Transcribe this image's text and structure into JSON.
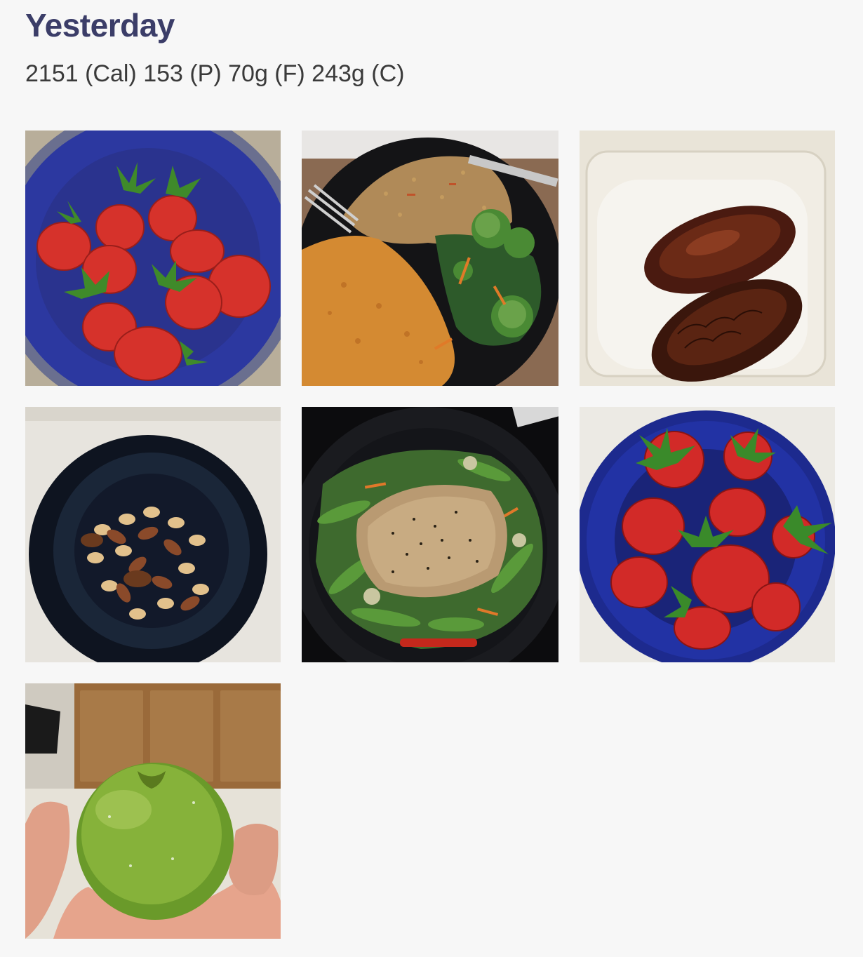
{
  "day": {
    "title": "Yesterday",
    "macros": "2151 (Cal) 153 (P) 70g (F) 243g (C)"
  },
  "photos": [
    {
      "subject": "strawberries-in-blue-bowl"
    },
    {
      "subject": "salmon-rice-vegetables-plate"
    },
    {
      "subject": "dates-in-container"
    },
    {
      "subject": "mixed-nuts-in-black-bowl"
    },
    {
      "subject": "chicken-stir-fry-in-pan"
    },
    {
      "subject": "strawberries-in-blue-bowl"
    },
    {
      "subject": "green-apple-in-hand"
    }
  ],
  "colors": {
    "title": "#3b3d68",
    "text": "#3a3a3a",
    "background": "#f7f7f7"
  }
}
